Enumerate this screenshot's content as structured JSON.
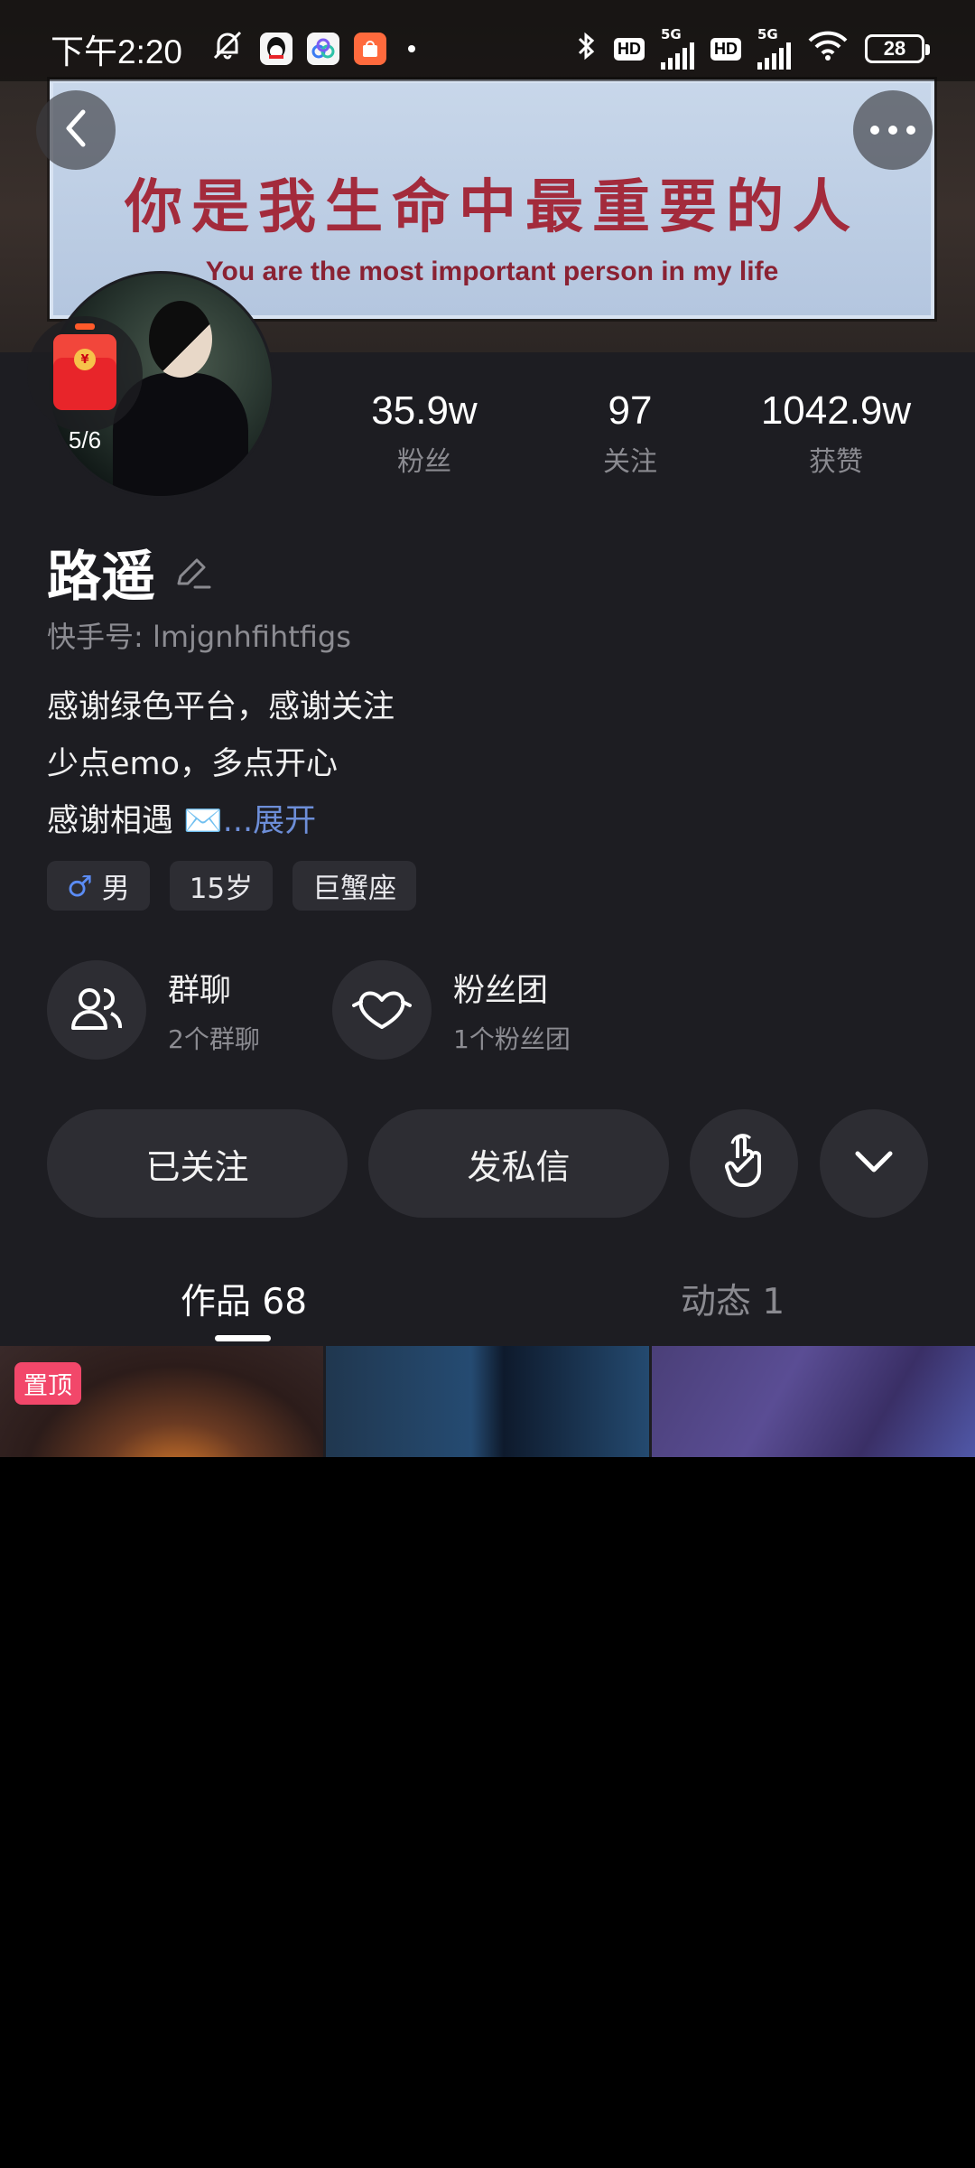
{
  "status_bar": {
    "time": "下午2:20",
    "battery": "28",
    "network": "5G",
    "hd_label": "HD"
  },
  "banner": {
    "title_cn": "你是我生命中最重要的人",
    "title_en": "You are the most important person in my life"
  },
  "profile": {
    "red_packet_count": "5/6",
    "stats": [
      {
        "value": "35.9w",
        "label": "粉丝"
      },
      {
        "value": "97",
        "label": "关注"
      },
      {
        "value": "1042.9w",
        "label": "获赞"
      }
    ],
    "name": "路遥",
    "kuaishou_id": "快手号: lmjgnhfihtfigs",
    "bio_lines": [
      "感谢绿色平台，感谢关注",
      "少点emo，多点开心",
      "感谢相遇 ✉️"
    ],
    "bio_expand": "...展开",
    "tags": {
      "gender": "男",
      "age": "15岁",
      "zodiac": "巨蟹座"
    },
    "group_chat": {
      "title": "群聊",
      "subtitle": "2个群聊"
    },
    "fan_club": {
      "title": "粉丝团",
      "subtitle": "1个粉丝团"
    }
  },
  "actions": {
    "followed": "已关注",
    "message": "发私信"
  },
  "tabs": [
    {
      "label": "作品 68",
      "active": true
    },
    {
      "label": "动态 1",
      "active": false
    }
  ],
  "grid": {
    "pinned_label": "置顶"
  }
}
